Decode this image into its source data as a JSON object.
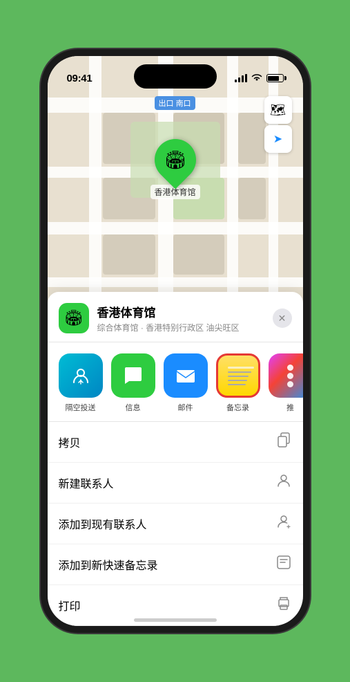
{
  "status": {
    "time": "09:41",
    "time_arrow": "◀"
  },
  "map": {
    "label": "南口",
    "label_prefix": "出口"
  },
  "venue": {
    "name": "香港体育馆",
    "description": "综合体育馆 · 香港特别行政区 油尖旺区",
    "pin_emoji": "🏟",
    "icon_emoji": "🏟"
  },
  "share_items": [
    {
      "id": "airdrop",
      "label": "隔空投送",
      "icon": "📡"
    },
    {
      "id": "messages",
      "label": "信息",
      "icon": "💬"
    },
    {
      "id": "mail",
      "label": "邮件",
      "icon": "✉️"
    },
    {
      "id": "notes",
      "label": "备忘录",
      "icon": ""
    },
    {
      "id": "more",
      "label": "推",
      "icon": "⋯"
    }
  ],
  "menu_items": [
    {
      "id": "copy",
      "label": "拷贝",
      "icon": "⧉"
    },
    {
      "id": "new-contact",
      "label": "新建联系人",
      "icon": "👤"
    },
    {
      "id": "add-existing",
      "label": "添加到现有联系人",
      "icon": "👤"
    },
    {
      "id": "add-notes",
      "label": "添加到新快速备忘录",
      "icon": "📝"
    },
    {
      "id": "print",
      "label": "打印",
      "icon": "🖨"
    }
  ],
  "buttons": {
    "close": "✕",
    "map_icon": "🗺",
    "location_icon": "➤"
  }
}
